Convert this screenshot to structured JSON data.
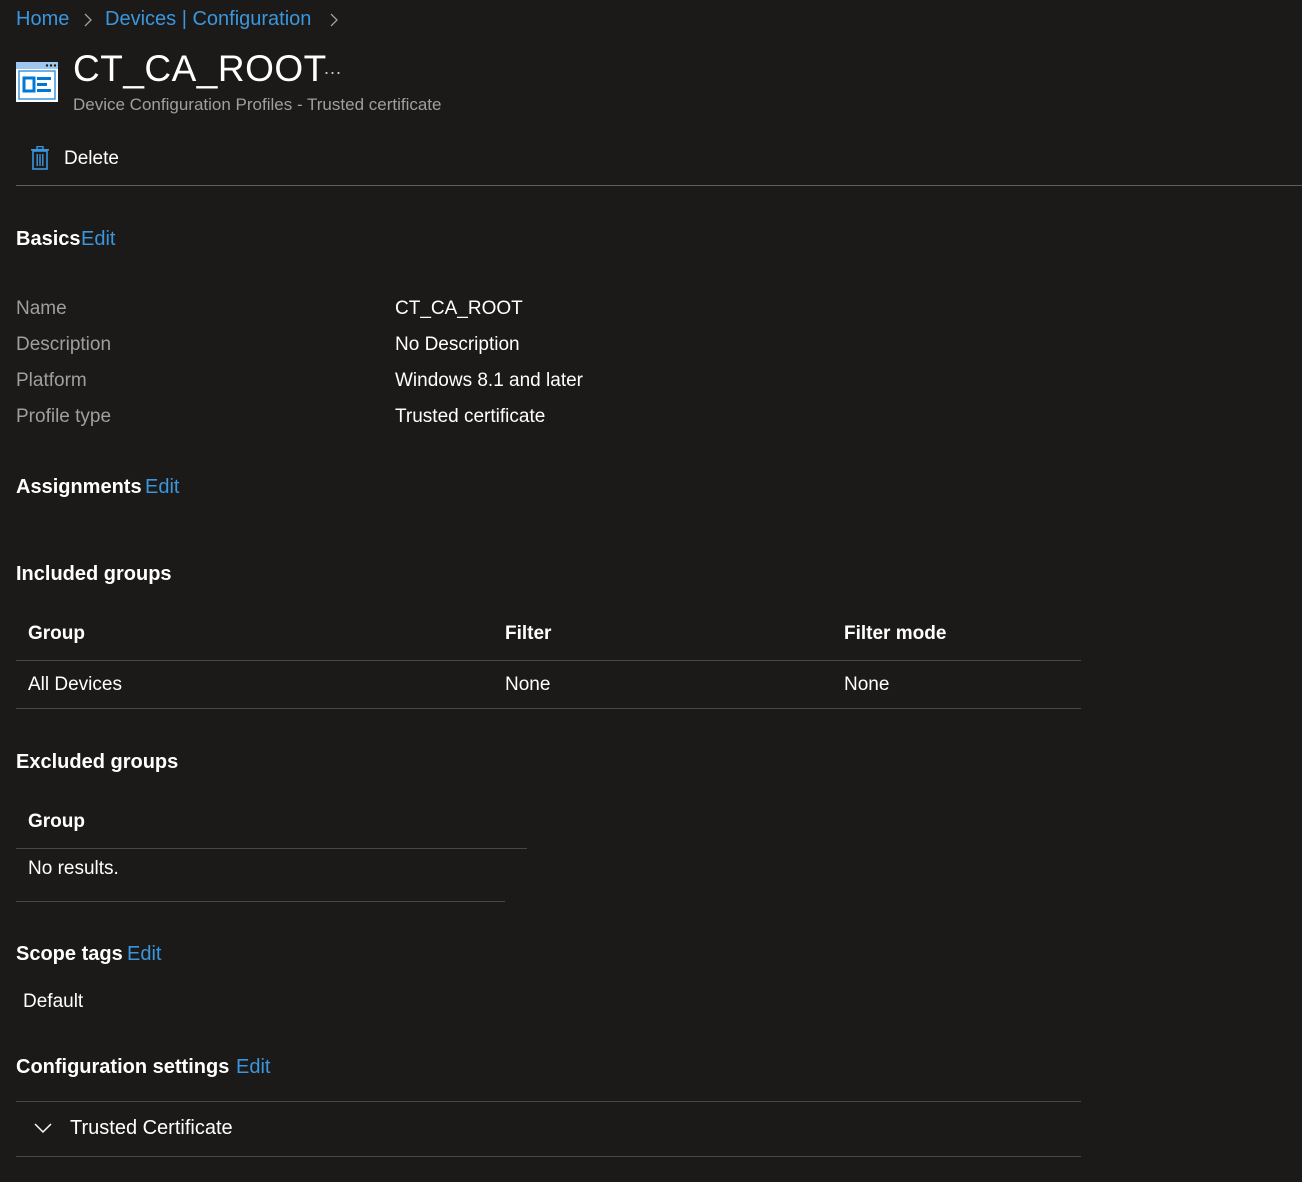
{
  "breadcrumb": {
    "items": [
      "Home",
      "Devices | Configuration"
    ]
  },
  "header": {
    "title": "CT_CA_ROOT",
    "subtitle": "Device Configuration Profiles - Trusted certificate",
    "more": "..."
  },
  "toolbar": {
    "delete_label": "Delete"
  },
  "basics": {
    "title": "Basics",
    "edit": "Edit",
    "rows": [
      {
        "label": "Name",
        "value": "CT_CA_ROOT"
      },
      {
        "label": "Description",
        "value": "No Description"
      },
      {
        "label": "Platform",
        "value": "Windows 8.1 and later"
      },
      {
        "label": "Profile type",
        "value": "Trusted certificate"
      }
    ]
  },
  "assignments": {
    "title": "Assignments",
    "edit": "Edit",
    "included": {
      "title": "Included groups",
      "columns": [
        "Group",
        "Filter",
        "Filter mode"
      ],
      "rows": [
        [
          "All Devices",
          "None",
          "None"
        ]
      ]
    },
    "excluded": {
      "title": "Excluded groups",
      "columns": [
        "Group"
      ],
      "empty_text": "No results."
    }
  },
  "scope_tags": {
    "title": "Scope tags",
    "edit": "Edit",
    "value": "Default"
  },
  "config_settings": {
    "title": "Configuration settings",
    "edit": "Edit",
    "item_label": "Trusted Certificate"
  },
  "colors": {
    "background": "#1b1a19",
    "link": "#3a96dd",
    "muted_text": "#a19f9d",
    "divider": "#484644"
  },
  "icons": {
    "profile": "profile-icon",
    "delete": "trash-icon",
    "breadcrumb_sep": "chevron-right-icon",
    "expand": "chevron-down-icon"
  }
}
